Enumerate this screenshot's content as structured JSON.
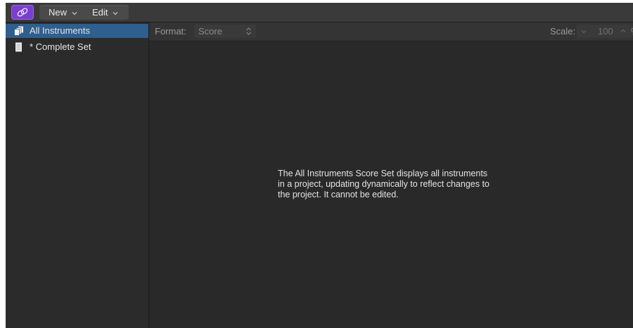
{
  "toolbar": {
    "new_label": "New",
    "edit_label": "Edit"
  },
  "sidebar": {
    "items": [
      {
        "label": "All Instruments",
        "icon": "stacked-pages-icon",
        "selected": true
      },
      {
        "label": "* Complete Set",
        "icon": "document-icon",
        "selected": false
      }
    ]
  },
  "main": {
    "format_label": "Format:",
    "format_value": "Score",
    "scale_label": "Scale:",
    "scale_value": "100",
    "scale_unit": "%",
    "message_lines": [
      "The All Instruments Score Set displays all instruments",
      "in a project, updating dynamically to reflect changes to",
      "the project. It cannot be edited."
    ]
  },
  "colors": {
    "accent_purple": "#7a3fd0",
    "selection_blue": "#2e5f8e",
    "background": "#2b2b2b"
  }
}
